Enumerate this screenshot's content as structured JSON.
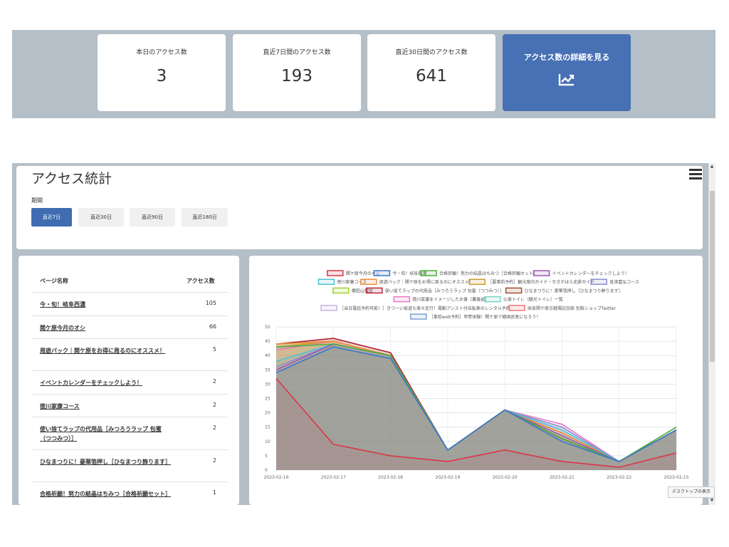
{
  "summary": {
    "today_label": "本日のアクセス数",
    "today_value": "3",
    "week_label": "直近7日間のアクセス数",
    "week_value": "193",
    "month_label": "直近30日間のアクセス数",
    "month_value": "641",
    "detail_label": "アクセス数の詳細を見る",
    "detail_icon": "chart-line-icon"
  },
  "stats": {
    "title": "アクセス統計",
    "period_label": "期間",
    "periods": [
      "直近7日",
      "直近30日",
      "直近90日",
      "直近180日"
    ],
    "active_period": "直近7日",
    "menu_icon": "hamburger-menu-icon"
  },
  "table": {
    "col_page": "ページ名称",
    "col_count": "アクセス数",
    "rows": [
      {
        "name": "今・旬！岐阜西濃",
        "count": "105"
      },
      {
        "name": "関ケ原今月のオシ",
        "count": "66"
      },
      {
        "name": "周遊パック｜関ケ原をお得に周るのにオススメ！",
        "count": "5"
      },
      {
        "name": "イベントカレンダーをチェックしよう！",
        "count": "2"
      },
      {
        "name": "徳川家康コース",
        "count": "2"
      },
      {
        "name": "使い捨てラップの代用品［みつろうラップ 包蜜（つつみつ）］",
        "count": "2"
      },
      {
        "name": "ひなまつりに！豪華箔押し［ひなまつり飾ります］",
        "count": "2"
      },
      {
        "name": "合格祈願！努力の結晶はちみつ［合格祈願セット］",
        "count": "1"
      }
    ]
  },
  "tooltip": "デスクトップの表示",
  "chart_data": {
    "type": "area",
    "x": [
      "2023-02-16",
      "2023-02-17",
      "2023-02-18",
      "2023-02-19",
      "2023-02-20",
      "2023-02-21",
      "2023-02-22",
      "2023-02-15"
    ],
    "ylim": [
      0,
      50
    ],
    "yticks": [
      0,
      5,
      10,
      15,
      20,
      25,
      30,
      35,
      40,
      45,
      50
    ],
    "grid": true,
    "legend_position": "top",
    "series": [
      {
        "name": "関ケ原今月のオシ",
        "color": "#dc3545",
        "values": [
          32,
          9,
          5,
          3,
          7,
          3,
          1,
          6
        ]
      },
      {
        "name": "今・旬！岐阜西濃",
        "color": "#3a78c8",
        "values": [
          34,
          43,
          39,
          7,
          21,
          10,
          3,
          14
        ]
      },
      {
        "name": "合格祈願！努力の結晶はちみつ［合格祈願セット］",
        "color": "#4caf3a",
        "values": [
          43,
          44,
          40,
          7,
          21,
          11,
          3,
          15
        ]
      },
      {
        "name": "イベントカレンダーをチェックしよう！",
        "color": "#9b59b6",
        "values": [
          35,
          44,
          40,
          7,
          21,
          12,
          3,
          14
        ]
      },
      {
        "name": "徳川家康コース",
        "color": "#4fc1d6",
        "values": [
          38,
          44,
          40,
          7,
          21,
          14,
          3,
          14
        ]
      },
      {
        "name": "周遊パック｜関ケ原をお得に周るのにオススメ！",
        "color": "#f08c3a",
        "values": [
          44,
          45,
          40,
          7,
          21,
          13,
          3,
          14
        ]
      },
      {
        "name": "［要事前予約］観光案内ガイド・せきがはら史跡ガイド",
        "color": "#c8a032",
        "values": [
          43,
          45,
          40,
          7,
          21,
          13,
          3,
          14
        ]
      },
      {
        "name": "息津嘉弘コース",
        "color": "#8c8cd2",
        "values": [
          36,
          44,
          40,
          7,
          21,
          15,
          3,
          14
        ]
      },
      {
        "name": "横田山服店",
        "color": "#a0d232",
        "values": [
          44,
          45,
          40,
          7,
          21,
          12,
          3,
          14
        ]
      },
      {
        "name": "使い捨てラップの代用品［みつろうラップ 包蜜（つつみつ）］",
        "color": "#b4283c",
        "values": [
          44,
          46,
          41,
          7,
          21,
          11,
          3,
          14
        ]
      },
      {
        "name": "ひなまつりに！豪華箔押し［ひなまつり飾ります］",
        "color": "#a0522d",
        "values": [
          44,
          46,
          41,
          7,
          21,
          11,
          3,
          14
        ]
      },
      {
        "name": "徳川家康をイメージしたお香［薫香談］",
        "color": "#e87bc4",
        "values": [
          42,
          45,
          40,
          7,
          21,
          16,
          3,
          14
        ]
      },
      {
        "name": "公衆トイレ（観光トイレ）一覧",
        "color": "#7fd2c8",
        "values": [
          38,
          44,
          40,
          7,
          21,
          15,
          3,
          14
        ]
      },
      {
        "name": "［当日電話予約可能！］きつーい坂道も楽々走行！電動アシスト付自転車のレンタル予約",
        "color": "#c8b4e6",
        "values": [
          36,
          44,
          40,
          7,
          21,
          14,
          3,
          14
        ]
      },
      {
        "name": "岐阜関ケ原古戦場記念館 別館ショップTwitter",
        "color": "#f07878",
        "values": [
          44,
          45,
          40,
          7,
          21,
          12,
          3,
          14
        ]
      },
      {
        "name": "［事前web予約］甲冑体験！関ケ原で戦国武者になろう！",
        "color": "#78a0d2",
        "values": [
          34,
          43,
          39,
          7,
          21,
          10,
          3,
          14
        ]
      }
    ]
  }
}
